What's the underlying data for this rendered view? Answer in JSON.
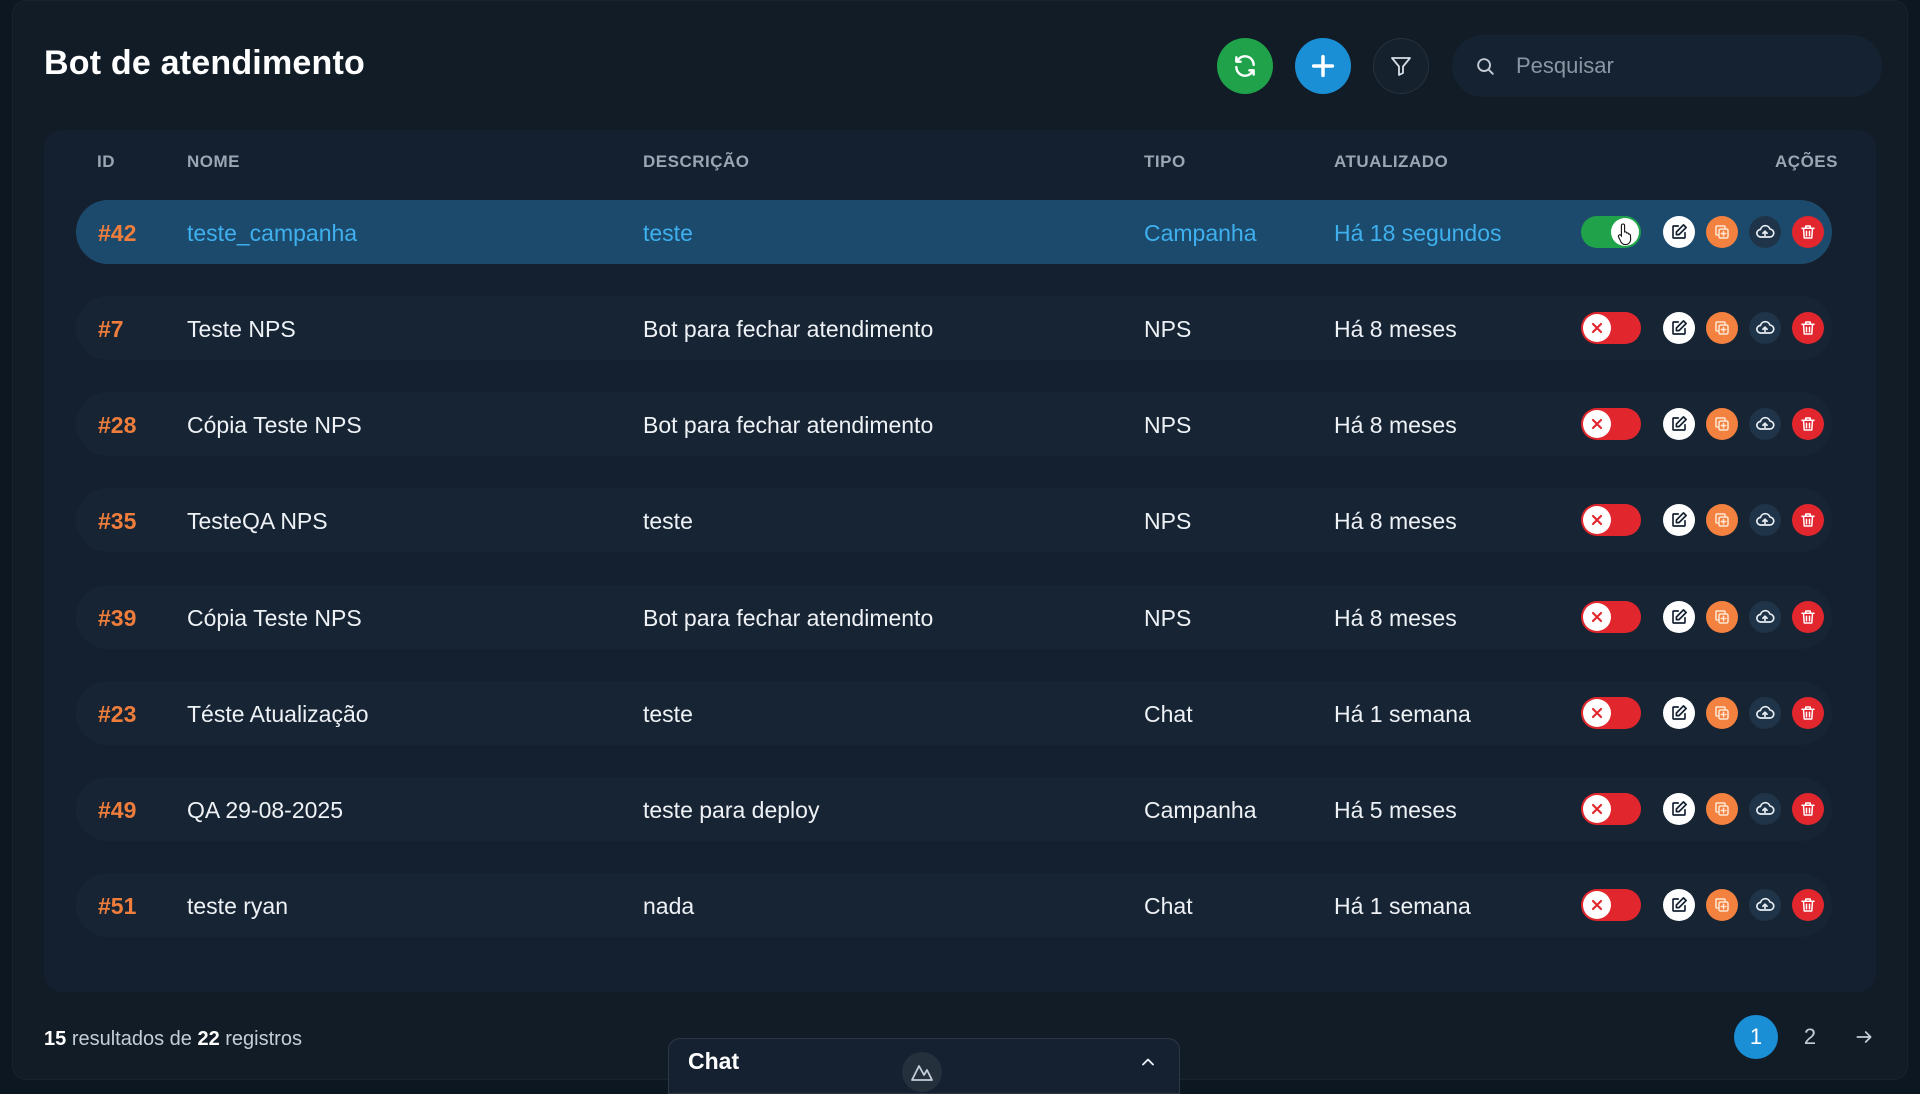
{
  "header": {
    "title": "Bot de atendimento",
    "search_placeholder": "Pesquisar"
  },
  "table": {
    "columns": {
      "id": "ID",
      "nome": "NOME",
      "descricao": "DESCRIÇÃO",
      "tipo": "TIPO",
      "atualizado": "ATUALIZADO",
      "acoes": "AÇÕES"
    },
    "rows": [
      {
        "id": "#42",
        "nome": "teste_campanha",
        "descricao": "teste",
        "tipo": "Campanha",
        "atualizado": "Há 18 segundos",
        "ativo": true
      },
      {
        "id": "#7",
        "nome": "Teste NPS",
        "descricao": "Bot para fechar atendimento",
        "tipo": "NPS",
        "atualizado": "Há 8 meses",
        "ativo": false
      },
      {
        "id": "#28",
        "nome": "Cópia Teste NPS",
        "descricao": "Bot para fechar atendimento",
        "tipo": "NPS",
        "atualizado": "Há 8 meses",
        "ativo": false
      },
      {
        "id": "#35",
        "nome": "TesteQA NPS",
        "descricao": "teste",
        "tipo": "NPS",
        "atualizado": "Há 8 meses",
        "ativo": false
      },
      {
        "id": "#39",
        "nome": "Cópia Teste NPS",
        "descricao": "Bot para fechar atendimento",
        "tipo": "NPS",
        "atualizado": "Há 8 meses",
        "ativo": false
      },
      {
        "id": "#23",
        "nome": "Téste Atualização",
        "descricao": "teste",
        "tipo": "Chat",
        "atualizado": "Há 1 semana",
        "ativo": false
      },
      {
        "id": "#49",
        "nome": "QA 29-08-2025",
        "descricao": "teste para deploy",
        "tipo": "Campanha",
        "atualizado": "Há 5 meses",
        "ativo": false
      },
      {
        "id": "#51",
        "nome": "teste ryan",
        "descricao": "nada",
        "tipo": "Chat",
        "atualizado": "Há 1 semana",
        "ativo": false
      }
    ]
  },
  "footer": {
    "shown": "15",
    "text_mid": "resultados de",
    "total": "22",
    "text_end": "registros"
  },
  "chat": {
    "title": "Chat"
  },
  "pagination": {
    "pages": [
      "1",
      "2"
    ],
    "current": "1"
  },
  "colors": {
    "accent_blue": "#1b8fd6",
    "success_green": "#1fa24a",
    "danger_red": "#e2262e",
    "id_orange": "#ef7d3c",
    "active_row": "#1c4a6c"
  }
}
